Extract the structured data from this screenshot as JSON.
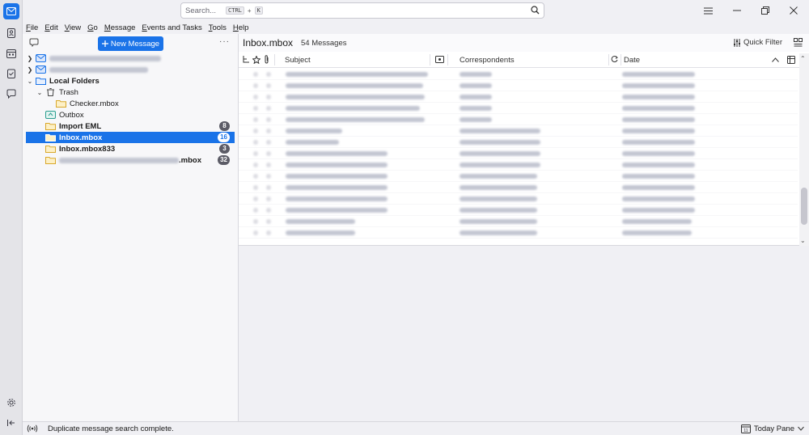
{
  "search": {
    "placeholder": "Search...",
    "key1": "CTRL",
    "plus": "+",
    "key2": "K"
  },
  "menu": [
    "File",
    "Edit",
    "View",
    "Go",
    "Message",
    "Events and Tasks",
    "Tools",
    "Help"
  ],
  "folder_pane": {
    "new_message_label": "New Message",
    "more_label": "···",
    "folders": {
      "local_folders": "Local Folders",
      "trash": "Trash",
      "checker": "Checker.mbox",
      "outbox": "Outbox",
      "import_eml": {
        "label": "Import EML",
        "count": "8"
      },
      "inbox_mbox": {
        "label": "Inbox.mbox",
        "count": "16"
      },
      "inbox_mbox833": {
        "label": "Inbox.mbox833",
        "count": "3"
      },
      "redacted_mbox": {
        "suffix": ".mbox",
        "count": "32"
      }
    }
  },
  "message_list": {
    "title": "Inbox.mbox",
    "count_label": "54 Messages",
    "quick_filter_label": "Quick Filter",
    "columns": {
      "subject": "Subject",
      "correspondents": "Correspondents",
      "date": "Date"
    }
  },
  "status": {
    "text": "Duplicate message search complete.",
    "today_pane_label": "Today Pane",
    "calendar_day": "11"
  },
  "colors": {
    "accent": "#1a73e8",
    "badge": "#5b5b66"
  }
}
